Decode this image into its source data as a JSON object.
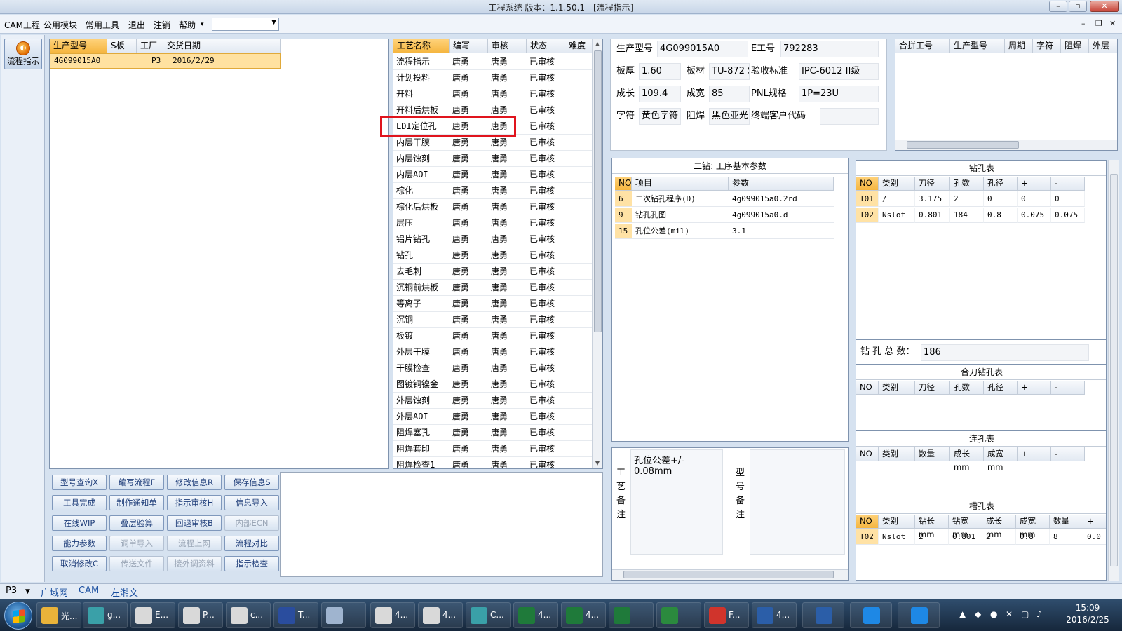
{
  "window": {
    "title": "工程系统  版本：1.1.50.1 - [流程指示]"
  },
  "menu": {
    "items": [
      "CAM工程",
      "公用模块",
      "常用工具",
      "退出",
      "注销",
      "帮助"
    ],
    "help_arrow": "▾",
    "combo_value": ""
  },
  "left_tool": {
    "flow_button": "流程指示"
  },
  "orders": {
    "headers": [
      "生产型号",
      "S板",
      "工厂",
      "交货日期"
    ],
    "rows": [
      {
        "model": "4G099015A0",
        "s": "",
        "factory": "P3",
        "date": "2016/2/29"
      }
    ]
  },
  "process": {
    "headers": [
      "工艺名称",
      "编写",
      "审核",
      "状态",
      "难度"
    ],
    "rows": [
      {
        "name": "流程指示",
        "writer": "唐勇",
        "reviewer": "唐勇",
        "status": "已审核"
      },
      {
        "name": "计划投料",
        "writer": "唐勇",
        "reviewer": "唐勇",
        "status": "已审核"
      },
      {
        "name": "开料",
        "writer": "唐勇",
        "reviewer": "唐勇",
        "status": "已审核"
      },
      {
        "name": "开料后烘板",
        "writer": "唐勇",
        "reviewer": "唐勇",
        "status": "已审核"
      },
      {
        "name": "LDI定位孔",
        "writer": "唐勇",
        "reviewer": "唐勇",
        "status": "已审核"
      },
      {
        "name": "内层干膜",
        "writer": "唐勇",
        "reviewer": "唐勇",
        "status": "已审核"
      },
      {
        "name": "内层蚀刻",
        "writer": "唐勇",
        "reviewer": "唐勇",
        "status": "已审核"
      },
      {
        "name": "内层AOI",
        "writer": "唐勇",
        "reviewer": "唐勇",
        "status": "已审核"
      },
      {
        "name": "棕化",
        "writer": "唐勇",
        "reviewer": "唐勇",
        "status": "已审核"
      },
      {
        "name": "棕化后烘板",
        "writer": "唐勇",
        "reviewer": "唐勇",
        "status": "已审核"
      },
      {
        "name": "层压",
        "writer": "唐勇",
        "reviewer": "唐勇",
        "status": "已审核"
      },
      {
        "name": "铝片钻孔",
        "writer": "唐勇",
        "reviewer": "唐勇",
        "status": "已审核"
      },
      {
        "name": "钻孔",
        "writer": "唐勇",
        "reviewer": "唐勇",
        "status": "已审核"
      },
      {
        "name": "去毛刺",
        "writer": "唐勇",
        "reviewer": "唐勇",
        "status": "已审核"
      },
      {
        "name": "沉铜前烘板",
        "writer": "唐勇",
        "reviewer": "唐勇",
        "status": "已审核"
      },
      {
        "name": "等离子",
        "writer": "唐勇",
        "reviewer": "唐勇",
        "status": "已审核"
      },
      {
        "name": "沉铜",
        "writer": "唐勇",
        "reviewer": "唐勇",
        "status": "已审核"
      },
      {
        "name": "板镀",
        "writer": "唐勇",
        "reviewer": "唐勇",
        "status": "已审核"
      },
      {
        "name": "外层干膜",
        "writer": "唐勇",
        "reviewer": "唐勇",
        "status": "已审核"
      },
      {
        "name": "干膜检查",
        "writer": "唐勇",
        "reviewer": "唐勇",
        "status": "已审核"
      },
      {
        "name": "图镀铜镍金",
        "writer": "唐勇",
        "reviewer": "唐勇",
        "status": "已审核"
      },
      {
        "name": "外层蚀刻",
        "writer": "唐勇",
        "reviewer": "唐勇",
        "status": "已审核"
      },
      {
        "name": "外层AOI",
        "writer": "唐勇",
        "reviewer": "唐勇",
        "status": "已审核"
      },
      {
        "name": "阻焊塞孔",
        "writer": "唐勇",
        "reviewer": "唐勇",
        "status": "已审核"
      },
      {
        "name": "阻焊套印",
        "writer": "唐勇",
        "reviewer": "唐勇",
        "status": "已审核"
      },
      {
        "name": "阻焊检查1",
        "writer": "唐勇",
        "reviewer": "唐勇",
        "status": "已审核"
      }
    ]
  },
  "buttons": [
    [
      "型号查询X",
      "编写流程F",
      "修改信息R",
      "保存信息S"
    ],
    [
      "工具完成",
      "制作通知单",
      "指示审核H",
      "信息导入"
    ],
    [
      "在线WIP",
      "叠层验算",
      "回退审核B",
      "内部ECN"
    ],
    [
      "能力参数",
      "调单导入",
      "流程上网",
      "流程对比"
    ],
    [
      "取消修改C",
      "传送文件",
      "接外调资料",
      "指示检查"
    ]
  ],
  "disabled_buttons": [
    "内部ECN",
    "调单导入",
    "流程上网",
    "传送文件",
    "接外调资料"
  ],
  "info": {
    "model_label": "生产型号",
    "model": "4G099015A0",
    "eno_label": "E工号",
    "eno": "792283",
    "thick_label": "板厚",
    "thick": "1.60",
    "mat_label": "板材",
    "mat": "TU-872 S",
    "std_label": "验收标准",
    "std": "IPC-6012 II级",
    "len_label": "成长",
    "len": "109.4",
    "wid_label": "成宽",
    "wid": "85",
    "pnl_label": "PNL规格",
    "pnl": "1P=23U",
    "char_label": "字符",
    "char": "黄色字符",
    "mask_label": "阻焊",
    "mask": "黑色亚光",
    "cust_label": "终端客户代码",
    "cust": ""
  },
  "combine": {
    "headers": [
      "合拼工号",
      "生产型号",
      "周期",
      "字符",
      "阻焊",
      "外层"
    ]
  },
  "drill_params": {
    "title": "二钻: 工序基本参数",
    "headers": [
      "NO",
      "项目",
      "参数"
    ],
    "rows": [
      {
        "no": "6",
        "item": "二次钻孔程序(D)",
        "param": "4g099015a0.2rd"
      },
      {
        "no": "9",
        "item": "钻孔孔图",
        "param": "4g099015a0.d"
      },
      {
        "no": "15",
        "item": "孔位公差(mil)",
        "param": "3.1"
      }
    ]
  },
  "drill_table": {
    "title": "钻孔表",
    "headers": [
      "NO",
      "类别",
      "刀径",
      "孔数",
      "孔径",
      "+",
      "-"
    ],
    "rows": [
      [
        "T01",
        "/",
        "3.175",
        "2",
        "0",
        "0",
        "0"
      ],
      [
        "T02",
        "Nslot",
        "0.801",
        "184",
        "0.8",
        "0.075",
        "0.075"
      ]
    ],
    "total_label": "钻 孔 总 数：",
    "total": "186"
  },
  "combo_drill": {
    "title": "合刀钻孔表",
    "headers": [
      "NO",
      "类别",
      "刀径",
      "孔数",
      "孔径",
      "+",
      "-"
    ]
  },
  "link_holes": {
    "title": "连孔表",
    "headers": [
      "NO",
      "类别",
      "数量",
      "成长mm",
      "成宽mm",
      "+",
      "-"
    ]
  },
  "slot_holes": {
    "title": "槽孔表",
    "headers": [
      "NO",
      "类别",
      "钻长mm",
      "钻宽mm",
      "成长mm",
      "成宽mm",
      "数量",
      "+"
    ],
    "rows": [
      [
        "T02",
        "Nslot",
        "2",
        "0.801",
        "2",
        "0.8",
        "8",
        "0.0"
      ]
    ]
  },
  "notes": {
    "process_label": "工艺备注",
    "process_text": "孔位公差+/-\n0.08mm",
    "model_label": "型号备注",
    "model_text": ""
  },
  "status": {
    "items": [
      "P3",
      "广域网",
      "CAM",
      "左湘文"
    ]
  },
  "taskbar": {
    "items": [
      "光...",
      "g...",
      "E...",
      "P...",
      "c...",
      "T...",
      "",
      "4...",
      "4...",
      "C...",
      "4...",
      "4...",
      "",
      "",
      "F...",
      "4..."
    ],
    "time": "15:09",
    "date": "2016/2/25"
  }
}
